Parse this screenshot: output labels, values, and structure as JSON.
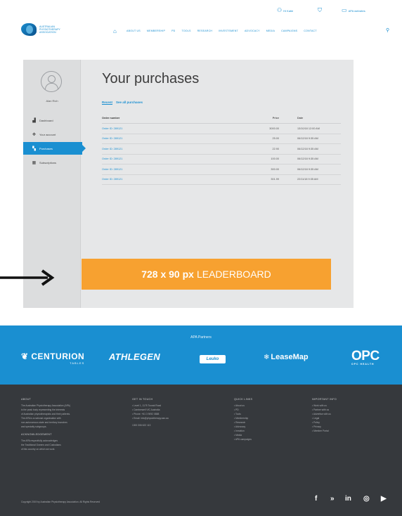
{
  "header": {
    "util_links": [
      {
        "icon": "user-icon",
        "label": "Hi Katie"
      },
      {
        "icon": "cart-icon",
        "label": ""
      },
      {
        "icon": "screen-icon",
        "label": "APA websites"
      }
    ],
    "logo_text": "AUSTRALIAN PHYSIOTHERAPY ASSOCIATION",
    "home_icon": "home-icon",
    "nav": [
      "ABOUT US",
      "MEMBERSHIP",
      "PD",
      "TOOLS",
      "RESEARCH",
      "INVESTSMENT",
      "ADVOCACY",
      "MEDIA",
      "CAMPAIGNS",
      "CONTACT"
    ],
    "search_icon": "search-icon"
  },
  "sidebar": {
    "user_name": "Alan Rich",
    "items": [
      {
        "icon": "dashboard-icon",
        "label": "Dashboard"
      },
      {
        "icon": "gear-icon",
        "label": "Your account"
      },
      {
        "icon": "cart-icon",
        "label": "Purchases"
      },
      {
        "icon": "list-icon",
        "label": "Subscriptions"
      }
    ]
  },
  "main": {
    "title": "Your purchases",
    "filters": [
      "Recent",
      "See all purchases"
    ],
    "columns": [
      "Order number",
      "Price",
      "Date"
    ],
    "rows": [
      {
        "order": "Order ID: 289121",
        "price": "3000.00",
        "date": "13/10/18  12:00 AM"
      },
      {
        "order": "Order ID: 289121",
        "price": "25.00",
        "date": "06/12/18   9:35 AM"
      },
      {
        "order": "Order ID: 289121",
        "price": "22.90",
        "date": "06/12/18   9:35 AM"
      },
      {
        "order": "Order ID: 289121",
        "price": "100.00",
        "date": "06/12/18   9:35 AM"
      },
      {
        "order": "Order ID: 289121",
        "price": "300.00",
        "date": "06/12/18   9:35 AM"
      },
      {
        "order": "Order ID: 289121",
        "price": "301.99",
        "date": "22/11/18   9:35 AM"
      }
    ]
  },
  "leaderboard": {
    "size": "728 x 90 px",
    "label": "LEADERBOARD"
  },
  "partners": {
    "title": "APA Partners",
    "centurion": "CENTURION",
    "centurion_sub": "TABLES",
    "athlegen": "ATHLEGEN",
    "leuko": "Leuko",
    "leasemap": "LeaseMap",
    "opc": "OPC",
    "opc_sub": "OPC HEALTH"
  },
  "footer": {
    "about": {
      "heading": "ABOUT",
      "lines": [
        "The Australian Physiotherapy Association (APA)",
        "is the peak body representing the interests",
        "of Australian physiotherapists and their patients.",
        "The APA is a national organisation with",
        "non-autonomous state and territory branches",
        "and specialty subgroups."
      ],
      "ack_heading": "ACKNOWLEDGEMENT",
      "ack_lines": [
        "The APA respectfully acknowledges",
        "the Traditional Owners and Custodians",
        "of this country on which we work."
      ]
    },
    "contact": {
      "heading": "GET IN TOUCH",
      "lines": [
        "Level 1, 1175 Toorak Road",
        "Camberwell VIC Australia",
        "Phone: +61 3 9092 0888",
        "Email: info@physiotherapy.asn.au"
      ],
      "phone": "1300 306 622 113"
    },
    "quick": {
      "heading": "QUICK LINKS",
      "lines": [
        "About us",
        "PD",
        "Tools",
        "Membership",
        "Research",
        "Advocacy",
        "Inmotion",
        "Media",
        "APA campaigns"
      ]
    },
    "important": {
      "heading": "IMPORTANT INFO",
      "lines": [
        "Work with us",
        "Partner with us",
        "Advertise with us",
        "Legal",
        "Policy",
        "Privacy",
        "Member Portal"
      ]
    },
    "copyright": "Copyright 2019 by Australian Physiotherapy Association. All Rights Reserved",
    "social": [
      {
        "icon": "facebook-icon",
        "glyph": "f"
      },
      {
        "icon": "twitter-icon",
        "glyph": "»"
      },
      {
        "icon": "linkedin-icon",
        "glyph": "in"
      },
      {
        "icon": "instagram-icon",
        "glyph": "◎"
      },
      {
        "icon": "youtube-icon",
        "glyph": "▶"
      }
    ]
  },
  "colors": {
    "brand_blue": "#1a8fd1",
    "leaderboard_orange": "#f7a130",
    "footer_dark": "#36393d"
  }
}
